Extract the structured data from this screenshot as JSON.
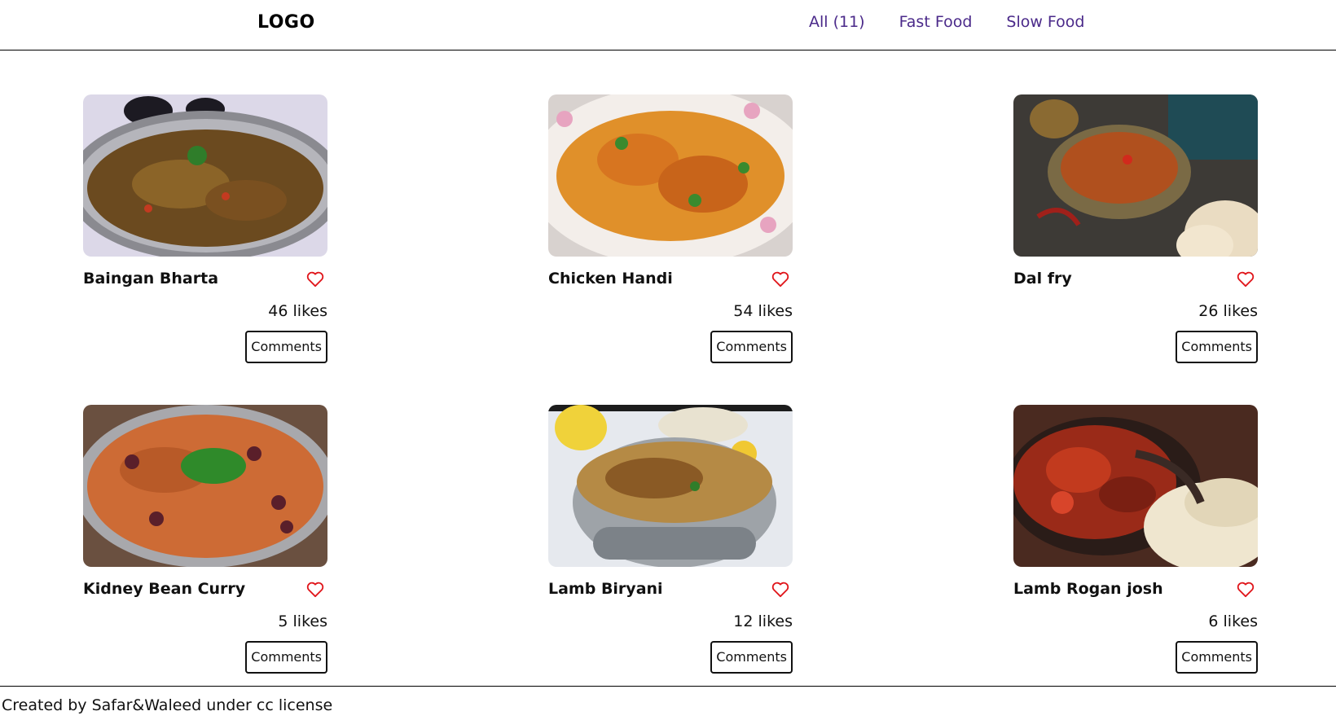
{
  "header": {
    "logo": "LOGO",
    "nav": [
      {
        "label": "All (11)"
      },
      {
        "label": "Fast Food"
      },
      {
        "label": "Slow Food"
      }
    ]
  },
  "meals": [
    {
      "name": "Baingan Bharta",
      "likes": "46 likes",
      "comments_label": "Comments",
      "image_icon": "baingan-bharta-photo"
    },
    {
      "name": "Chicken Handi",
      "likes": "54 likes",
      "comments_label": "Comments",
      "image_icon": "chicken-handi-photo"
    },
    {
      "name": "Dal fry",
      "likes": "26 likes",
      "comments_label": "Comments",
      "image_icon": "dal-fry-photo"
    },
    {
      "name": "Kidney Bean Curry",
      "likes": "5 likes",
      "comments_label": "Comments",
      "image_icon": "kidney-bean-curry-photo"
    },
    {
      "name": "Lamb Biryani",
      "likes": "12 likes",
      "comments_label": "Comments",
      "image_icon": "lamb-biryani-photo"
    },
    {
      "name": "Lamb Rogan josh",
      "likes": "6 likes",
      "comments_label": "Comments",
      "image_icon": "lamb-rogan-josh-photo"
    }
  ],
  "footer": {
    "text": "Created by Safar&Waleed under cc license"
  },
  "colors": {
    "nav_link": "#4b2a8a",
    "heart": "#e0161b",
    "border": "#111111"
  }
}
